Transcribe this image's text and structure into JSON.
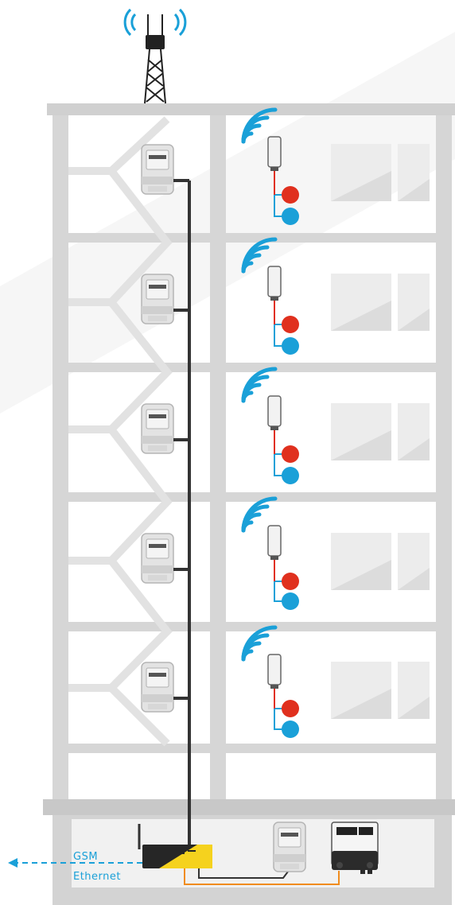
{
  "labels": {
    "gsm": "GSM",
    "ethernet": "Ethernet"
  },
  "floors": [
    {
      "index": 1,
      "elements": [
        "electricity-meter",
        "wireless-transmitter",
        "hot-water-sensor",
        "cold-water-sensor",
        "window"
      ]
    },
    {
      "index": 2,
      "elements": [
        "electricity-meter",
        "wireless-transmitter",
        "hot-water-sensor",
        "cold-water-sensor",
        "window"
      ]
    },
    {
      "index": 3,
      "elements": [
        "electricity-meter",
        "wireless-transmitter",
        "hot-water-sensor",
        "cold-water-sensor",
        "window"
      ]
    },
    {
      "index": 4,
      "elements": [
        "electricity-meter",
        "wireless-transmitter",
        "hot-water-sensor",
        "cold-water-sensor",
        "window"
      ]
    },
    {
      "index": 5,
      "elements": [
        "electricity-meter",
        "wireless-transmitter",
        "hot-water-sensor",
        "cold-water-sensor",
        "window"
      ]
    }
  ],
  "basement": {
    "devices": [
      "data-concentrator",
      "electricity-meter",
      "heat-meter"
    ]
  },
  "rooftop": {
    "device": "antenna-tower-icon"
  },
  "colors": {
    "wifi": "#1aa0d8",
    "hot_water": "#e0301e",
    "cold_water": "#1aa0d8",
    "bus_line": "#333333",
    "orange_cable": "#f08c1e",
    "concentrator_accent": "#f5d21e",
    "building": "#d9d9d9"
  }
}
